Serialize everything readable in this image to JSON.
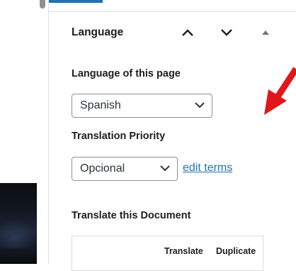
{
  "sidebar": {
    "section_title": "Language",
    "language_label": "Language of this page",
    "language_value": "Spanish",
    "priority_label": "Translation Priority",
    "priority_value": "Opcional",
    "edit_terms_link": "edit terms",
    "translate_doc_label": "Translate this Document",
    "table_headers": [
      "Translate",
      "Duplicate"
    ]
  },
  "colors": {
    "accent": "#2271b1",
    "annotation_arrow": "#e0161b"
  },
  "icons": {
    "move_up": "chevron-up-icon",
    "move_down": "chevron-down-icon",
    "toggle": "triangle-up-icon",
    "select_chevron": "chevron-down-icon",
    "annotation": "red-arrow-icon"
  }
}
